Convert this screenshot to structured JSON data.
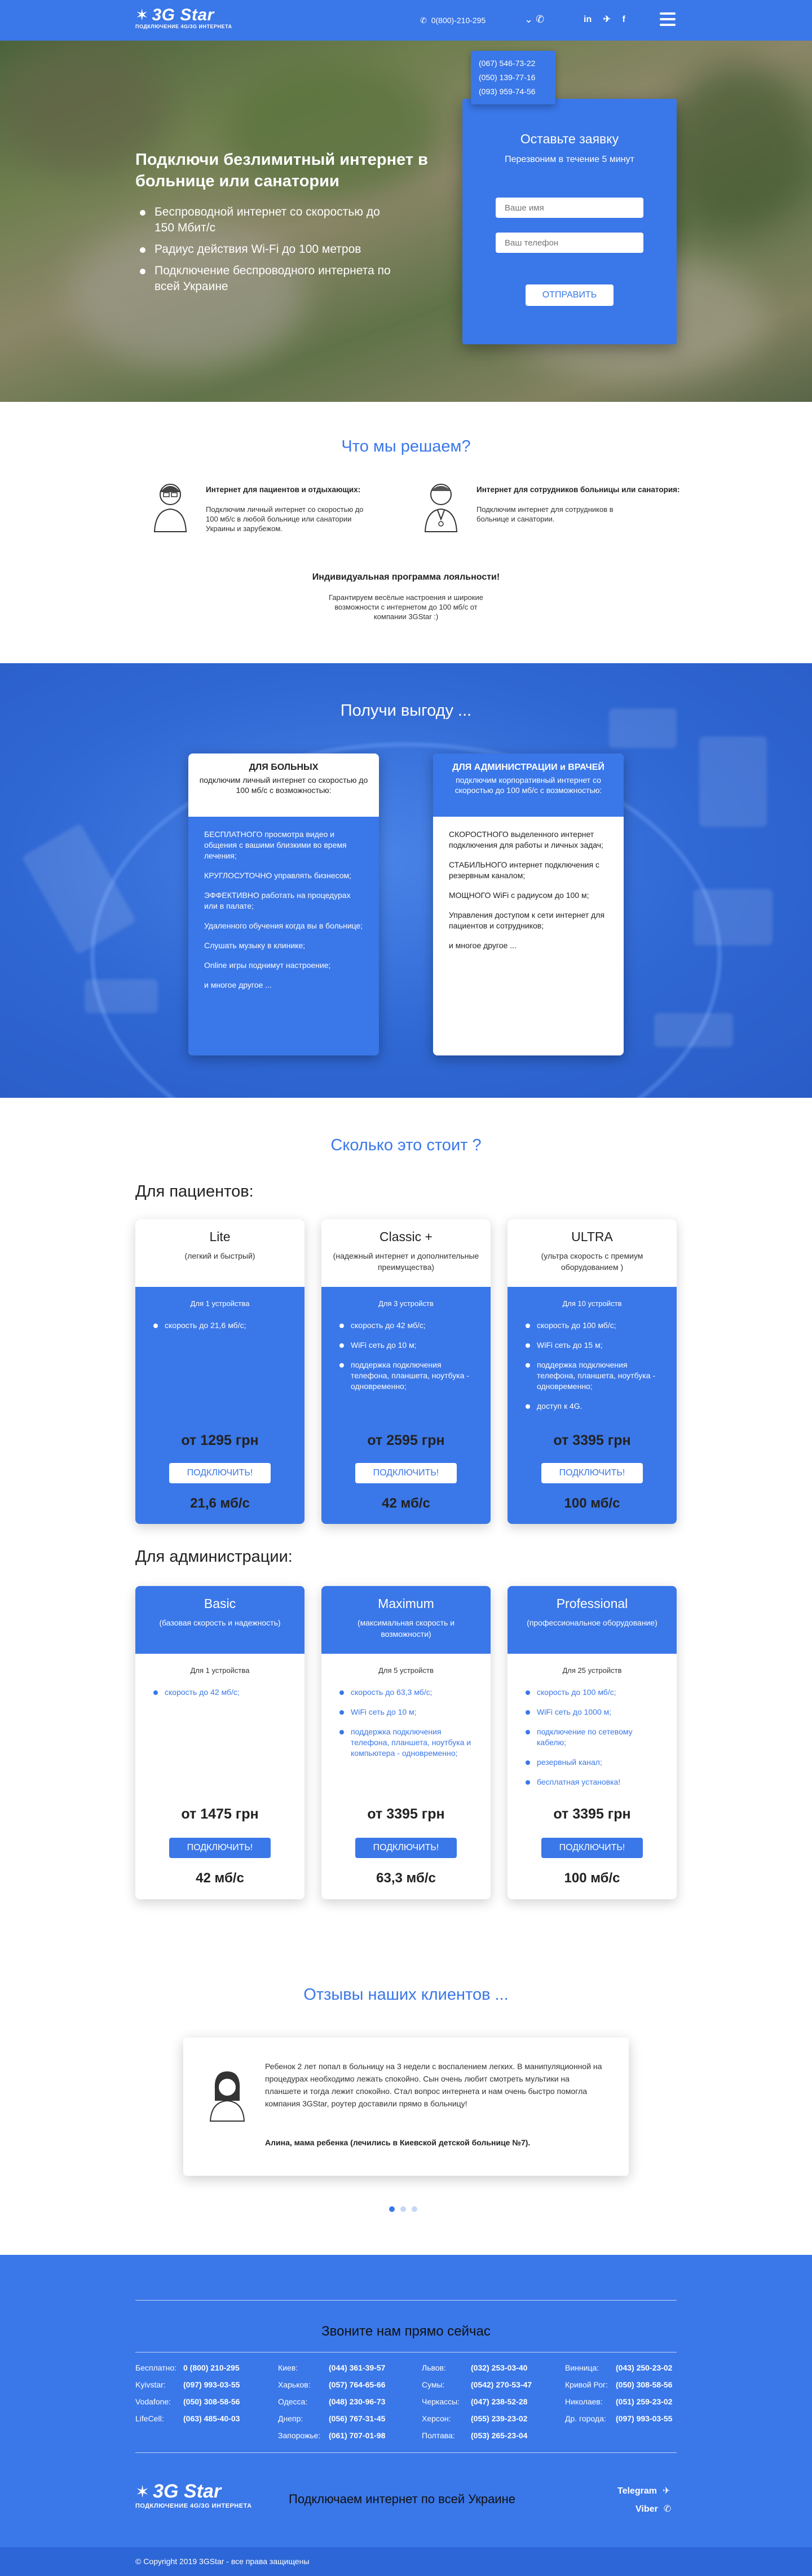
{
  "header": {
    "logo": "3G Star",
    "logo_sub": "ПОДКЛЮЧЕНИЕ 4G/3G ИНТЕРНЕТА",
    "phone": "0(800)-210-295",
    "social": [
      "in",
      "✈",
      "f"
    ],
    "phone_dropdown": [
      "(067) 546-73-22",
      "(050) 139-77-16",
      "(093) 959-74-56"
    ]
  },
  "hero": {
    "title": "Подключи безлимитный интернет в больнице или санатории",
    "bullets": [
      "Беспроводной интернет со скоростью до 150 Мбит/с",
      "Радиус действия Wi-Fi до 100 метров",
      "Подключение беспроводного интернета по всей Украине"
    ],
    "form": {
      "title": "Оставьте заявку",
      "subtitle": "Перезвоним в течение 5 минут",
      "name_placeholder": "Ваше имя",
      "phone_placeholder": "Ваш телефон",
      "submit": "ОТПРАВИТЬ"
    }
  },
  "solve": {
    "title": "Что мы решаем?",
    "items": [
      {
        "title": "Интернет для пациентов и отдыхающих:",
        "text": "Подключим личный интернет со скоростью до 100 мб/с в любой больнице или санатории Украины и зарубежом."
      },
      {
        "title": "Интернет для сотрудников больницы или санатория:",
        "text": "Подключим интернет для сотрудников в больнице и санатории."
      }
    ],
    "loyalty_title": "Индивидуальная программа лояльности!",
    "loyalty_text": "Гарантируем весёлые настроения и широкие возможности с интернетом до 100 мб/с от компании 3GStar :)"
  },
  "benefits": {
    "title": "Получи выгоду ...",
    "cards": [
      {
        "title": "ДЛЯ БОЛЬНЫХ",
        "subtitle": "подключим личный интернет со скоростью до 100 мб/с с возможностью:",
        "items": [
          "БЕСПЛАТНОГО просмотра видео и общения с вашими близкими во время лечения;",
          "КРУГЛОСУТОЧНО управлять бизнесом;",
          "ЭФФЕКТИВНО работать на процедурах или в палате;",
          "Удаленного обучения когда вы в больнице;",
          "Слушать музыку в клинике;",
          "Online игры поднимут настроение;",
          "и многое другое ..."
        ]
      },
      {
        "title": "ДЛЯ АДМИНИСТРАЦИИ и ВРАЧЕЙ",
        "subtitle": "подключим корпоративный интернет со скоростью до 100 мб/с с возможностью:",
        "items": [
          "СКОРОСТНОГО выделенного интернет подключения для работы и личных задач;",
          "СТАБИЛЬНОГО интернет подключения с резервным каналом;",
          "МОЩНОГО WiFi с радиусом до 100 м;",
          "Управления доступом к сети интернет для пациентов и сотрудников;",
          "и многое другое ..."
        ]
      }
    ]
  },
  "prices": {
    "title": "Сколько это стоит ?",
    "patients_title": "Для пациентов:",
    "admin_title": "Для администрации:",
    "patients": [
      {
        "name": "Lite",
        "desc": "(легкий и быстрый)",
        "devices": "Для 1 устройства",
        "items": [
          "скорость до 21,6 мб/с;"
        ],
        "price": "от 1295 грн",
        "button": "ПОДКЛЮЧИТЬ!",
        "speed": "21,6 мб/с"
      },
      {
        "name": "Classic +",
        "desc": "(надежный интернет и дополнительные преимущества)",
        "devices": "Для 3 устройств",
        "items": [
          "скорость до 42 мб/с;",
          "WiFi сеть до 10 м;",
          "поддержка подключения телефона, планшета, ноутбука - одновременно;"
        ],
        "price": "от 2595 грн",
        "button": "ПОДКЛЮЧИТЬ!",
        "speed": "42 мб/с"
      },
      {
        "name": "ULTRA",
        "desc": "(ультра скорость с премиум оборудованием )",
        "devices": "Для 10 устройств",
        "items": [
          "скорость до 100 мб/с;",
          "WiFi сеть до 15 м;",
          "поддержка подключения телефона, планшета, ноутбука - одновременно;",
          "доступ к 4G."
        ],
        "price": "от 3395 грн",
        "button": "ПОДКЛЮЧИТЬ!",
        "speed": "100 мб/с"
      }
    ],
    "admin": [
      {
        "name": "Basic",
        "desc": "(базовая скорость и надежность)",
        "devices": "Для 1 устройства",
        "items": [
          "скорость до 42 мб/с;"
        ],
        "price": "от 1475 грн",
        "button": "ПОДКЛЮЧИТЬ!",
        "speed": "42 мб/с"
      },
      {
        "name": "Maximum",
        "desc": "(максимальная скорость и возможности)",
        "devices": "Для 5 устройств",
        "items": [
          "скорость до 63,3 мб/с;",
          "WiFi сеть до 10 м;",
          "поддержка подключения телефона, планшета, ноутбука и компьютера - одновременно;"
        ],
        "price": "от 3395 грн",
        "button": "ПОДКЛЮЧИТЬ!",
        "speed": "63,3 мб/с"
      },
      {
        "name": "Professional",
        "desc": "(профессиональное оборудование)",
        "devices": "Для 25 устройств",
        "items": [
          "скорость до 100 мб/с;",
          "WiFi сеть до 1000 м;",
          "подключение по сетевому кабелю;",
          "резервный канал;",
          "бесплатная установка!"
        ],
        "price": "от 3395 грн",
        "button": "ПОДКЛЮЧИТЬ!",
        "speed": "100 мб/с"
      }
    ]
  },
  "reviews": {
    "title": "Отзывы наших клиентов ...",
    "text": "Ребенок 2 лет попал в больницу на 3 недели с воспалением легких. В манипуляционной на процедурах необходимо лежать спокойно. Сын очень любит смотреть мультики на планшете и тогда лежит спокойно. Стал вопрос интернета и нам очень быстро помогла компания 3GStar, роутер доставили прямо в больницу!",
    "author": "Алина, мама ребенка (лечились в Киевской детской больнице №7)."
  },
  "footer": {
    "title": "Звоните нам прямо сейчас",
    "contacts": [
      [
        [
          "Бесплатно:",
          "0 (800) 210-295"
        ],
        [
          "Kyivstar:",
          "(097) 993-03-55"
        ],
        [
          "Vodafone:",
          "(050) 308-58-56"
        ],
        [
          "LifeCell:",
          "(063) 485-40-03"
        ]
      ],
      [
        [
          "Киев:",
          "(044) 361-39-57"
        ],
        [
          "Харьков:",
          "(057) 764-65-66"
        ],
        [
          "Одесса:",
          "(048) 230-96-73"
        ],
        [
          "Днепр:",
          "(056) 767-31-45"
        ],
        [
          "Запорожье:",
          "(061) 707-01-98"
        ]
      ],
      [
        [
          "Львов:",
          "(032) 253-03-40"
        ],
        [
          "Сумы:",
          "(0542) 270-53-47"
        ],
        [
          "Черкассы:",
          "(047) 238-52-28"
        ],
        [
          "Херсон:",
          "(055) 239-23-02"
        ],
        [
          "Полтава:",
          "(053) 265-23-04"
        ]
      ],
      [
        [
          "Винница:",
          "(043) 250-23-02"
        ],
        [
          "Кривой Рог:",
          "(050) 308-58-56"
        ],
        [
          "Николаев:",
          "(051) 259-23-02"
        ],
        [
          "Др. города:",
          "(097) 993-03-55"
        ]
      ]
    ],
    "logo": "3G Star",
    "logo_sub": "ПОДКЛЮЧЕНИЕ 4G/3G ИНТЕРНЕТА",
    "slogan": "Подключаем интернет по всей Украине",
    "telegram": "Telegram",
    "viber": "Viber",
    "copyright": "© Copyright 2019 3GStar - все права защищены"
  }
}
